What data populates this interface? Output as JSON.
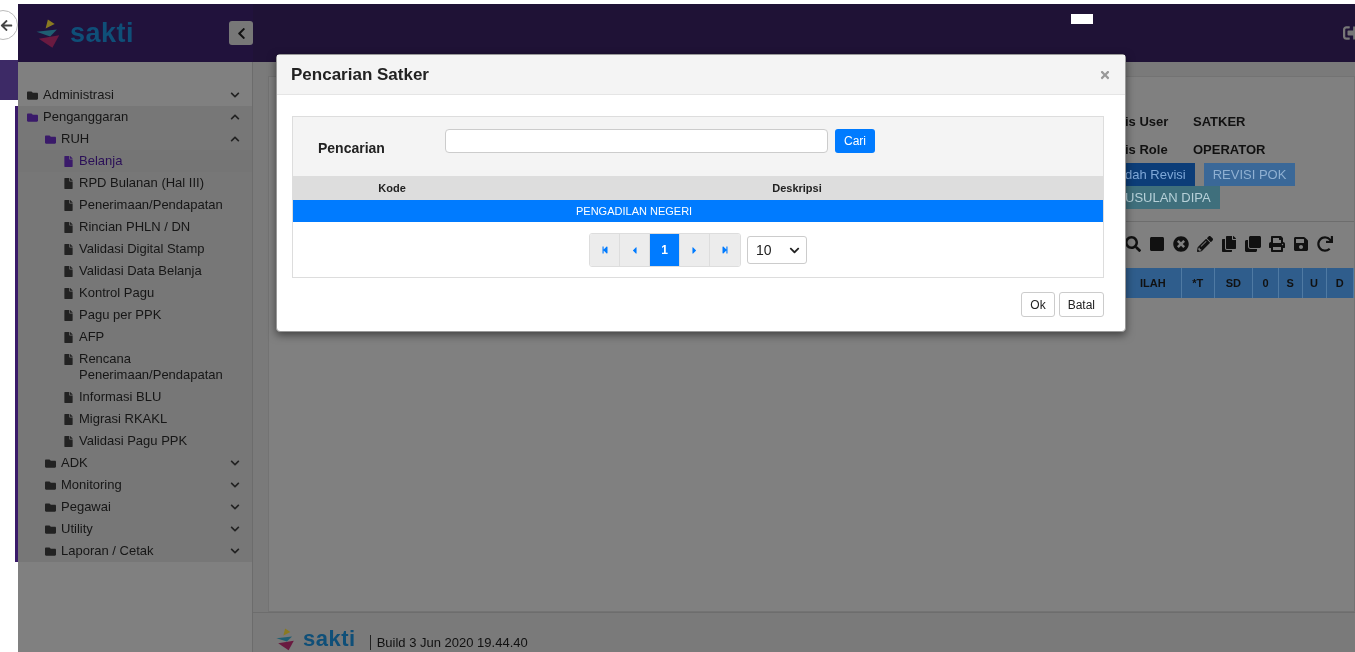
{
  "header": {
    "logo_text": "sakti"
  },
  "sidebar": {
    "items": [
      {
        "label": "Administrasi",
        "kind": "folder",
        "expanded": false,
        "selected": false
      },
      {
        "label": "Penganggaran",
        "kind": "folder",
        "expanded": true,
        "selected": false,
        "children": [
          {
            "label": "RUH",
            "kind": "folder",
            "expanded": true,
            "selected": false,
            "children": [
              {
                "label": "Belanja",
                "kind": "file",
                "selected": true
              },
              {
                "label": "RPD Bulanan (Hal III)",
                "kind": "file",
                "selected": false
              },
              {
                "label": "Penerimaan/Pendapatan",
                "kind": "file",
                "selected": false
              },
              {
                "label": "Rincian PHLN / DN",
                "kind": "file",
                "selected": false
              },
              {
                "label": "Validasi Digital Stamp",
                "kind": "file",
                "selected": false
              },
              {
                "label": "Validasi Data Belanja",
                "kind": "file",
                "selected": false
              },
              {
                "label": "Kontrol Pagu",
                "kind": "file",
                "selected": false
              },
              {
                "label": "Pagu per PPK",
                "kind": "file",
                "selected": false
              },
              {
                "label": "AFP",
                "kind": "file",
                "selected": false
              },
              {
                "label": "Rencana Penerimaan/Pendapatan",
                "kind": "file",
                "selected": false
              },
              {
                "label": "Informasi BLU",
                "kind": "file",
                "selected": false
              },
              {
                "label": "Migrasi RKAKL",
                "kind": "file",
                "selected": false
              },
              {
                "label": "Validasi Pagu PPK",
                "kind": "file",
                "selected": false
              }
            ]
          },
          {
            "label": "ADK",
            "kind": "folder",
            "expanded": false,
            "selected": false
          },
          {
            "label": "Monitoring",
            "kind": "folder",
            "expanded": false,
            "selected": false
          },
          {
            "label": "Pegawai",
            "kind": "folder",
            "expanded": false,
            "selected": false
          },
          {
            "label": "Utility",
            "kind": "folder",
            "expanded": false,
            "selected": false
          },
          {
            "label": "Laporan / Cetak",
            "kind": "folder",
            "expanded": false,
            "selected": false
          }
        ]
      }
    ]
  },
  "content": {
    "info": [
      {
        "label": "is User",
        "value": "SATKER"
      },
      {
        "label": "is Role",
        "value": "OPERATOR"
      }
    ],
    "buttons": [
      {
        "label": "dah Revisi",
        "kind": "primary"
      },
      {
        "label": "REVISI POK",
        "kind": "light"
      },
      {
        "label": "USULAN DIPA",
        "kind": "teal"
      }
    ],
    "table_columns": [
      "ILAH",
      "*T",
      "SD",
      "0",
      "S",
      "U",
      "D"
    ]
  },
  "footer": {
    "logo_text": "sakti",
    "build": "Build 3 Jun 2020 19.44.40"
  },
  "dialog": {
    "title": "Pencarian Satker",
    "search_label": "Pencarian",
    "search_button": "Cari",
    "columns": [
      "Kode",
      "Deskripsi"
    ],
    "rows": [
      {
        "cells": [
          "",
          "PENGADILAN NEGERI"
        ],
        "selected": true
      }
    ],
    "pages": [
      {
        "label": "1",
        "selected": true
      }
    ],
    "page_size": "10",
    "buttons": [
      "Ok",
      "Batal"
    ]
  }
}
